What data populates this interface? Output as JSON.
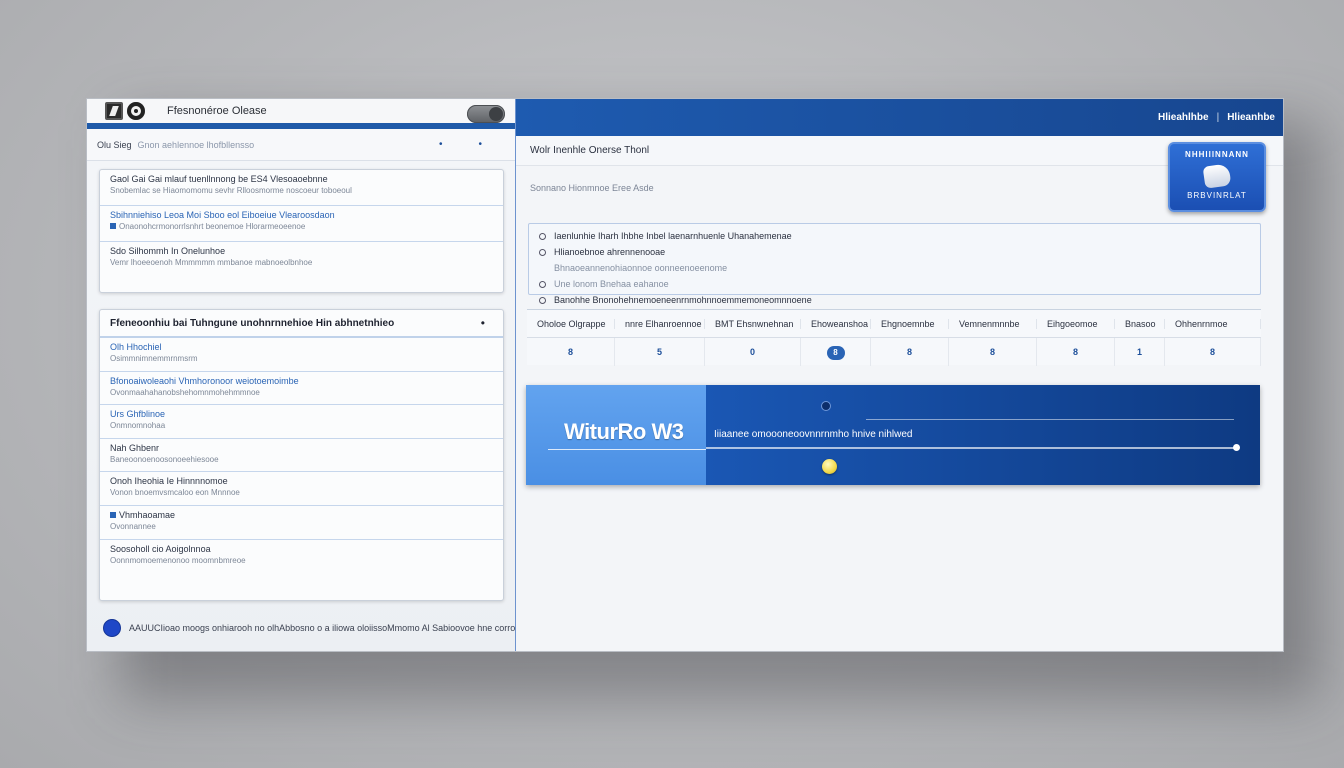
{
  "window": {
    "title": "Ffesnonéroe Olease"
  },
  "left": {
    "toolbar": {
      "label": "Olu Sieg",
      "hint": "Gnon  aehlennoe lhofbllensso"
    },
    "card1": {
      "rows": [
        {
          "l1": "Gaol Gai Gai mlauf tuenllnnong be ES4 Vlesoaoebnne",
          "l2": "Snobemlac se Hiaomomomu sevhr Rlloosmorme noscoeur toboeoul",
          "blue": false
        },
        {
          "l1": "Sbihnniehiso Leoa Moi Sboo eol Eiboeiue Vlearoosdaon",
          "l2": "Onaonohcrmonorrlsnhrt beonemoe Hlorarmeoeenoe",
          "blue": true
        },
        {
          "l1": "Sdo Silhommh In Onelunhoe",
          "l2": "Vemr lhoeeoenoh Mmmmmm mmbanoe mabnoeolbnhoe",
          "blue": false
        }
      ]
    },
    "card2": {
      "title": "Ffeneoonhiu bai Tuhngune unohnrnnehioe Hin abhnetnhieo",
      "rows": [
        {
          "l1": "Olh Hhochiel",
          "l2": "Osimmnimnemmrnmsrm",
          "blue": true
        },
        {
          "l1": "Bfonoaiwoleaohi   Vhmhoronoor weiotoemoimbe",
          "l2": "Ovonmaahahanobshehomnmohehmmnoe",
          "blue": true
        },
        {
          "l1": "Urs Ghfblinoe",
          "l2": "Onmnomnohaa",
          "blue": true
        },
        {
          "l1": "Nah Ghbenr",
          "l2": "Baneoonoenoosonoeehiesooe",
          "blue": false
        },
        {
          "l1": "Onoh Iheohia Ie Hinnnnomoe",
          "l2": "Vonon bnoemvsmcaloo eon Mnnnoe",
          "blue": false
        },
        {
          "l1": "Vhmhaoamae",
          "l2": "Ovonnannee",
          "blue": true
        },
        {
          "l1": "Soosoholl cio Aoigolnnoa",
          "l2": "Oonnmomoemenonoo moomnbmreoe",
          "blue": false
        }
      ]
    },
    "status": {
      "text": "AAUUCIioao moogs  onhiarooh no olhAbbosno o a iliowa oloiissoMmomo Al  Sabioovoe hne corro"
    }
  },
  "right": {
    "header": {
      "left_label": "Hlieahlhbe",
      "right_label": "Hlieanhbe"
    },
    "subheader": "Wolr   Inenhle Onerse Thonl",
    "description": "Sonnano Hionmnoe Eree Asde",
    "badge": {
      "top": "NHHlllNNANN",
      "bottom": "BRBVINRLAT"
    },
    "options": [
      {
        "text": "Iaenlunhie Iharh Ihbhe Inbel laenarnhuenle Uhanahemenae",
        "dim": false
      },
      {
        "text": "Hlianoebnoe ahrennenooae",
        "dim": false
      },
      {
        "text": "Bhnaoeannenohiaonnoe oonneenoeenome",
        "dim": true
      },
      {
        "text": "Une lonom Bnehaa eahanoe",
        "dim": true
      },
      {
        "text": "Banohhe Bnonohehnemoeneenrnmohnnoemmemoneomnnoene",
        "dim": false
      }
    ],
    "stats": {
      "headers": [
        "Oholoe  Olgrappe",
        "nnre  Elhanroennoe",
        "BMT  Ehsnwnehnan",
        "Ehoweanshoa",
        "Ehgnoemnbe",
        "Vemnenmnnbe",
        "Eihgoeomoe",
        "Bnasoo",
        "Ohhenrnmoe"
      ],
      "values": [
        "8",
        "5",
        "0",
        "8",
        "8",
        "8",
        "8",
        "1",
        "8"
      ],
      "highlight_index": 3
    },
    "banner": {
      "title": "WiturRo W3",
      "subtitle": "Iiiaanee omoooneoovnnrnmho  hnive nihlwed"
    }
  },
  "colors": {
    "brand_blue": "#1e5bb0",
    "banner_light": "#4a8fe4",
    "banner_dark": "#0e3a82",
    "accent_yellow": "#f2d84a"
  }
}
